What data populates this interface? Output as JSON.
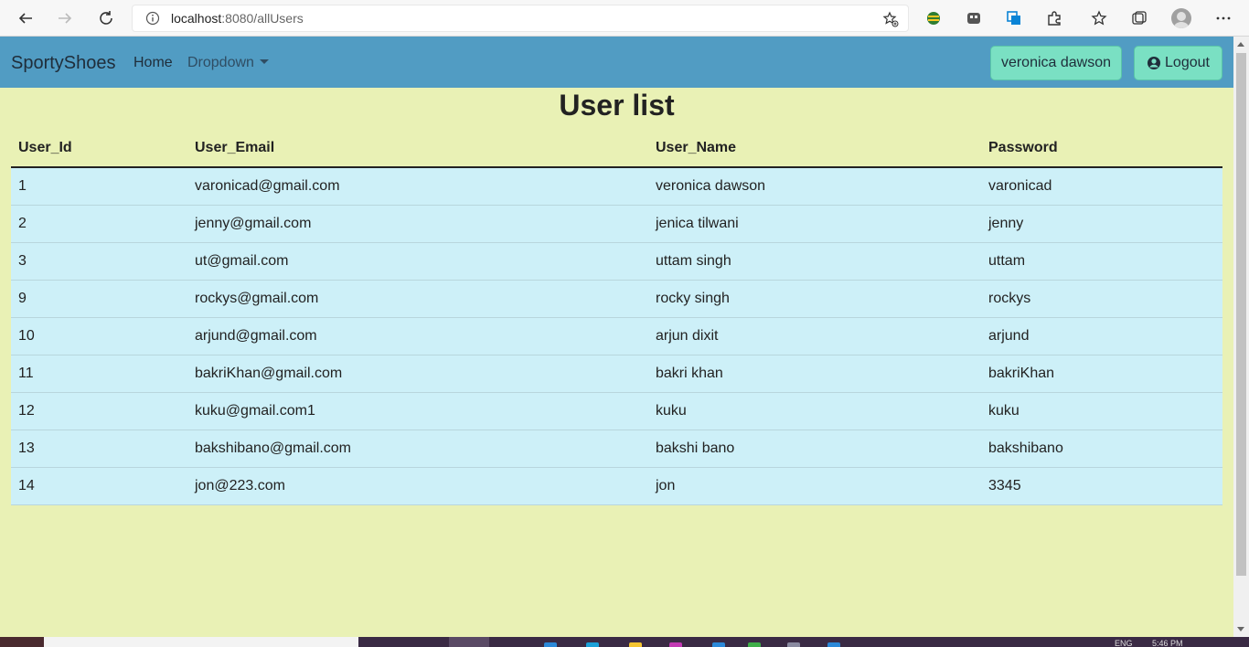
{
  "browser": {
    "url_host": "localhost",
    "url_path": ":8080/allUsers"
  },
  "navbar": {
    "brand": "SportyShoes",
    "home": "Home",
    "dropdown": "Dropdown",
    "user_button": "veronica dawson",
    "logout_button": "Logout"
  },
  "page": {
    "title": "User list"
  },
  "table": {
    "headers": [
      "User_Id",
      "User_Email",
      "User_Name",
      "Password"
    ],
    "rows": [
      [
        "1",
        "varonicad@gmail.com",
        "veronica dawson",
        "varonicad"
      ],
      [
        "2",
        "jenny@gmail.com",
        "jenica tilwani",
        "jenny"
      ],
      [
        "3",
        "ut@gmail.com",
        "uttam singh",
        "uttam"
      ],
      [
        "9",
        "rockys@gmail.com",
        "rocky singh",
        "rockys"
      ],
      [
        "10",
        "arjund@gmail.com",
        "arjun dixit",
        "arjund"
      ],
      [
        "11",
        "bakriKhan@gmail.com",
        "bakri khan",
        "bakriKhan"
      ],
      [
        "12",
        "kuku@gmail.com1",
        "kuku",
        "kuku"
      ],
      [
        "13",
        "bakshibano@gmail.com",
        "bakshi bano",
        "bakshibano"
      ],
      [
        "14",
        "jon@223.com",
        "jon",
        "3345"
      ]
    ]
  },
  "taskbar": {
    "lang": "ENG",
    "time": "5:46 PM"
  }
}
